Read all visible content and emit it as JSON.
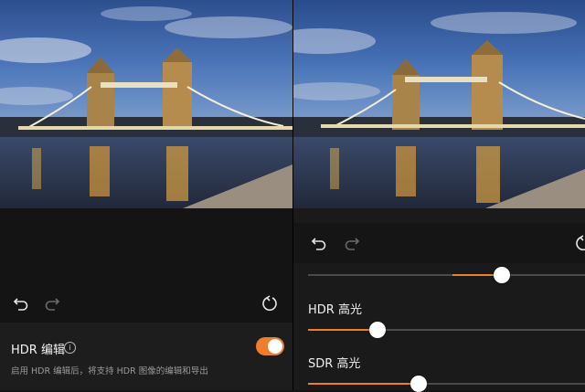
{
  "left_panel": {
    "undo_icon": "undo-icon",
    "redo_icon": "redo-icon",
    "reset_icon": "reset-icon",
    "hdr_edit": {
      "label": "HDR 编辑",
      "info_icon": "i",
      "description": "启用 HDR 编辑后，将支持 HDR 图像的编辑和导出",
      "enabled": true
    }
  },
  "right_panel": {
    "undo_icon": "undo-icon",
    "redo_icon": "redo-icon",
    "reset_icon": "reset-icon",
    "sliders": [
      {
        "label": "",
        "value": 0.7,
        "fill_from": 0.52
      },
      {
        "label": "HDR 高光",
        "value": 0.25,
        "fill_from": 0.0
      },
      {
        "label": "SDR 高光",
        "value": 0.4,
        "fill_from": 0.0
      }
    ]
  },
  "colors": {
    "accent": "#ef7d2e",
    "background": "#141414"
  }
}
